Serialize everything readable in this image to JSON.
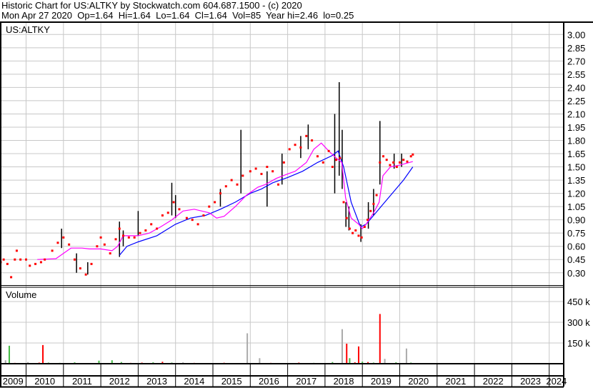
{
  "header": {
    "title": "Historic Chart for US:ALTKY by Stockwatch.com 604.687.1500 - (c) 2020",
    "quote": "Mon Apr 27 2020  Op=1.64  Hi=1.64  Lo=1.64  Cl=1.64  Vol=85  Year hi=2.46  lo=0.25"
  },
  "chart_data": [
    {
      "type": "line",
      "title": "US:ALTKY",
      "xlabel": "",
      "ylabel": "",
      "ylim": [
        0.15,
        3.1
      ],
      "xlim": [
        2009.3,
        2024.4
      ],
      "y_ticks": [
        "3.00",
        "2.85",
        "2.70",
        "2.55",
        "2.40",
        "2.25",
        "2.10",
        "1.95",
        "1.80",
        "1.65",
        "1.50",
        "1.35",
        "1.20",
        "1.05",
        "0.90",
        "0.75",
        "0.60",
        "0.45",
        "0.30"
      ],
      "x_ticks": [
        "2009",
        "2010",
        "2011",
        "2012",
        "2013",
        "2014",
        "2015",
        "2016",
        "2017",
        "2018",
        "2019",
        "2020",
        "2021",
        "2022",
        "2023",
        "2024"
      ],
      "grid": true,
      "colors": {
        "close": "#ff0000",
        "range": "#000000",
        "ma_short": "#ff00ff",
        "ma_long": "#0000ff"
      },
      "close": [
        [
          2009.32,
          0.42
        ],
        [
          2009.4,
          0.45
        ],
        [
          2009.5,
          0.4
        ],
        [
          2009.6,
          0.25
        ],
        [
          2009.7,
          0.45
        ],
        [
          2009.75,
          0.55
        ],
        [
          2009.85,
          0.45
        ],
        [
          2010.0,
          0.45
        ],
        [
          2010.1,
          0.38
        ],
        [
          2010.25,
          0.4
        ],
        [
          2010.4,
          0.42
        ],
        [
          2010.5,
          0.45
        ],
        [
          2010.7,
          0.55
        ],
        [
          2010.85,
          0.64
        ],
        [
          2011.0,
          0.7
        ],
        [
          2011.15,
          0.62
        ],
        [
          2011.3,
          0.45
        ],
        [
          2011.45,
          0.35
        ],
        [
          2011.6,
          0.28
        ],
        [
          2011.75,
          0.4
        ],
        [
          2011.9,
          0.6
        ],
        [
          2012.0,
          0.7
        ],
        [
          2012.1,
          0.62
        ],
        [
          2012.25,
          0.52
        ],
        [
          2012.4,
          0.68
        ],
        [
          2012.5,
          0.8
        ],
        [
          2012.6,
          0.72
        ],
        [
          2012.75,
          0.7
        ],
        [
          2012.9,
          0.7
        ],
        [
          2013.05,
          0.75
        ],
        [
          2013.2,
          0.78
        ],
        [
          2013.35,
          0.85
        ],
        [
          2013.5,
          0.8
        ],
        [
          2013.65,
          0.95
        ],
        [
          2013.8,
          0.98
        ],
        [
          2013.95,
          1.1
        ],
        [
          2014.1,
          1.02
        ],
        [
          2014.3,
          0.92
        ],
        [
          2014.45,
          0.9
        ],
        [
          2014.6,
          0.85
        ],
        [
          2014.75,
          0.95
        ],
        [
          2014.9,
          1.05
        ],
        [
          2015.05,
          1.1
        ],
        [
          2015.2,
          1.2
        ],
        [
          2015.35,
          1.28
        ],
        [
          2015.5,
          1.35
        ],
        [
          2015.65,
          1.3
        ],
        [
          2015.8,
          1.4
        ],
        [
          2016.0,
          1.45
        ],
        [
          2016.15,
          1.48
        ],
        [
          2016.3,
          1.42
        ],
        [
          2016.45,
          1.5
        ],
        [
          2016.6,
          1.45
        ],
        [
          2016.75,
          1.3
        ],
        [
          2016.9,
          1.55
        ],
        [
          2017.05,
          1.7
        ],
        [
          2017.2,
          1.75
        ],
        [
          2017.35,
          1.72
        ],
        [
          2017.5,
          1.85
        ],
        [
          2017.65,
          1.8
        ],
        [
          2017.8,
          1.62
        ],
        [
          2017.95,
          1.55
        ],
        [
          2018.1,
          1.68
        ],
        [
          2018.2,
          1.5
        ],
        [
          2018.3,
          1.58
        ],
        [
          2018.4,
          1.6
        ],
        [
          2018.5,
          1.1
        ],
        [
          2018.58,
          0.92
        ],
        [
          2018.66,
          0.8
        ],
        [
          2018.74,
          0.75
        ],
        [
          2018.82,
          0.78
        ],
        [
          2018.9,
          0.72
        ],
        [
          2018.98,
          0.7
        ],
        [
          2019.06,
          0.82
        ],
        [
          2019.14,
          0.9
        ],
        [
          2019.22,
          1.0
        ],
        [
          2019.3,
          1.08
        ],
        [
          2019.38,
          1.18
        ],
        [
          2019.47,
          1.55
        ],
        [
          2019.56,
          1.62
        ],
        [
          2019.65,
          1.58
        ],
        [
          2019.74,
          1.52
        ],
        [
          2019.83,
          1.55
        ],
        [
          2019.92,
          1.5
        ],
        [
          2020.0,
          1.55
        ],
        [
          2020.1,
          1.58
        ],
        [
          2020.2,
          1.56
        ],
        [
          2020.3,
          1.62
        ],
        [
          2020.35,
          1.64
        ]
      ],
      "ranges": [
        [
          2011.35,
          0.3,
          0.52
        ],
        [
          2011.65,
          0.28,
          0.42
        ],
        [
          2010.95,
          0.58,
          0.8
        ],
        [
          2012.5,
          0.48,
          0.88
        ],
        [
          2012.6,
          0.6,
          0.78
        ],
        [
          2013.0,
          0.72,
          1.0
        ],
        [
          2013.9,
          0.95,
          1.32
        ],
        [
          2014.0,
          0.92,
          1.18
        ],
        [
          2015.2,
          1.05,
          1.25
        ],
        [
          2015.75,
          1.2,
          1.92
        ],
        [
          2016.45,
          1.05,
          1.45
        ],
        [
          2016.85,
          1.3,
          1.65
        ],
        [
          2017.35,
          1.6,
          1.85
        ],
        [
          2017.55,
          1.7,
          1.98
        ],
        [
          2018.26,
          1.2,
          2.1
        ],
        [
          2018.38,
          1.4,
          2.46
        ],
        [
          2018.46,
          1.25,
          1.92
        ],
        [
          2018.56,
          0.82,
          1.1
        ],
        [
          2018.64,
          0.78,
          1.05
        ],
        [
          2018.96,
          0.65,
          0.85
        ],
        [
          2019.16,
          0.8,
          1.1
        ],
        [
          2019.3,
          0.95,
          1.25
        ],
        [
          2019.47,
          1.3,
          2.02
        ],
        [
          2019.85,
          1.48,
          1.65
        ],
        [
          2020.05,
          1.5,
          1.65
        ]
      ],
      "ma_short": [
        [
          2010.3,
          0.45
        ],
        [
          2010.8,
          0.46
        ],
        [
          2011.0,
          0.52
        ],
        [
          2011.2,
          0.58
        ],
        [
          2011.5,
          0.58
        ],
        [
          2011.7,
          0.57
        ],
        [
          2012.0,
          0.57
        ],
        [
          2012.3,
          0.55
        ],
        [
          2012.45,
          0.6
        ],
        [
          2012.6,
          0.72
        ],
        [
          2013.0,
          0.72
        ],
        [
          2013.3,
          0.75
        ],
        [
          2013.6,
          0.82
        ],
        [
          2013.9,
          0.9
        ],
        [
          2014.2,
          1.0
        ],
        [
          2014.5,
          1.02
        ],
        [
          2014.9,
          0.98
        ],
        [
          2015.1,
          0.92
        ],
        [
          2015.3,
          0.94
        ],
        [
          2015.6,
          1.05
        ],
        [
          2015.9,
          1.18
        ],
        [
          2016.2,
          1.27
        ],
        [
          2016.4,
          1.3
        ],
        [
          2016.7,
          1.37
        ],
        [
          2017.0,
          1.42
        ],
        [
          2017.2,
          1.45
        ],
        [
          2017.5,
          1.55
        ],
        [
          2017.7,
          1.7
        ],
        [
          2017.9,
          1.77
        ],
        [
          2018.1,
          1.68
        ],
        [
          2018.3,
          1.6
        ],
        [
          2018.45,
          1.55
        ],
        [
          2018.55,
          1.15
        ],
        [
          2018.7,
          0.92
        ],
        [
          2018.9,
          0.85
        ],
        [
          2019.0,
          0.8
        ],
        [
          2019.1,
          0.85
        ],
        [
          2019.3,
          0.98
        ],
        [
          2019.45,
          1.1
        ],
        [
          2019.55,
          1.4
        ],
        [
          2019.75,
          1.5
        ],
        [
          2020.0,
          1.52
        ],
        [
          2020.35,
          1.56
        ]
      ],
      "ma_long": [
        [
          2012.5,
          0.5
        ],
        [
          2012.7,
          0.6
        ],
        [
          2013.0,
          0.65
        ],
        [
          2013.5,
          0.72
        ],
        [
          2014.0,
          0.85
        ],
        [
          2014.4,
          0.92
        ],
        [
          2014.8,
          0.95
        ],
        [
          2015.2,
          1.02
        ],
        [
          2015.6,
          1.1
        ],
        [
          2016.0,
          1.2
        ],
        [
          2016.3,
          1.25
        ],
        [
          2016.6,
          1.32
        ],
        [
          2017.0,
          1.38
        ],
        [
          2017.4,
          1.45
        ],
        [
          2017.8,
          1.55
        ],
        [
          2018.2,
          1.63
        ],
        [
          2018.35,
          1.68
        ],
        [
          2018.5,
          1.5
        ],
        [
          2018.7,
          1.1
        ],
        [
          2018.95,
          0.82
        ],
        [
          2019.1,
          0.85
        ],
        [
          2019.3,
          0.95
        ],
        [
          2019.5,
          1.05
        ],
        [
          2019.8,
          1.2
        ],
        [
          2020.1,
          1.35
        ],
        [
          2020.35,
          1.5
        ]
      ]
    },
    {
      "type": "bar",
      "title": "Volume",
      "ylim": [
        0,
        540
      ],
      "y_ticks": [
        "450 k",
        "300 k",
        "150 k"
      ],
      "y_tick_values": [
        450,
        300,
        150
      ],
      "colors": {
        "up": "#44bb44",
        "down": "#ff0000",
        "flat": "#aaaaaa"
      },
      "bars": [
        [
          2009.32,
          10,
          "up"
        ],
        [
          2009.45,
          25,
          "flat"
        ],
        [
          2009.55,
          130,
          "up"
        ],
        [
          2009.7,
          6,
          "down"
        ],
        [
          2010.05,
          12,
          "flat"
        ],
        [
          2010.35,
          8,
          "down"
        ],
        [
          2010.45,
          135,
          "down"
        ],
        [
          2010.6,
          8,
          "up"
        ],
        [
          2010.9,
          6,
          "up"
        ],
        [
          2011.3,
          10,
          "up"
        ],
        [
          2011.6,
          5,
          "down"
        ],
        [
          2011.95,
          22,
          "up"
        ],
        [
          2012.3,
          25,
          "up"
        ],
        [
          2012.55,
          12,
          "up"
        ],
        [
          2012.8,
          6,
          "down"
        ],
        [
          2013.1,
          8,
          "down"
        ],
        [
          2013.4,
          10,
          "up"
        ],
        [
          2013.65,
          14,
          "down"
        ],
        [
          2013.9,
          8,
          "up"
        ],
        [
          2014.2,
          10,
          "flat"
        ],
        [
          2014.5,
          6,
          "down"
        ],
        [
          2014.9,
          5,
          "up"
        ],
        [
          2015.3,
          7,
          "down"
        ],
        [
          2015.92,
          220,
          "flat"
        ],
        [
          2016.25,
          40,
          "flat"
        ],
        [
          2016.55,
          6,
          "down"
        ],
        [
          2016.9,
          5,
          "up"
        ],
        [
          2017.3,
          8,
          "down"
        ],
        [
          2017.7,
          6,
          "up"
        ],
        [
          2018.2,
          12,
          "up"
        ],
        [
          2018.46,
          250,
          "flat"
        ],
        [
          2018.58,
          145,
          "down"
        ],
        [
          2018.66,
          40,
          "up"
        ],
        [
          2018.8,
          10,
          "down"
        ],
        [
          2018.9,
          125,
          "down"
        ],
        [
          2019.0,
          15,
          "up"
        ],
        [
          2019.15,
          12,
          "down"
        ],
        [
          2019.3,
          8,
          "up"
        ],
        [
          2019.47,
          360,
          "down"
        ],
        [
          2019.6,
          35,
          "flat"
        ],
        [
          2019.9,
          10,
          "up"
        ],
        [
          2020.18,
          110,
          "flat"
        ],
        [
          2020.3,
          8,
          "up"
        ]
      ]
    }
  ]
}
